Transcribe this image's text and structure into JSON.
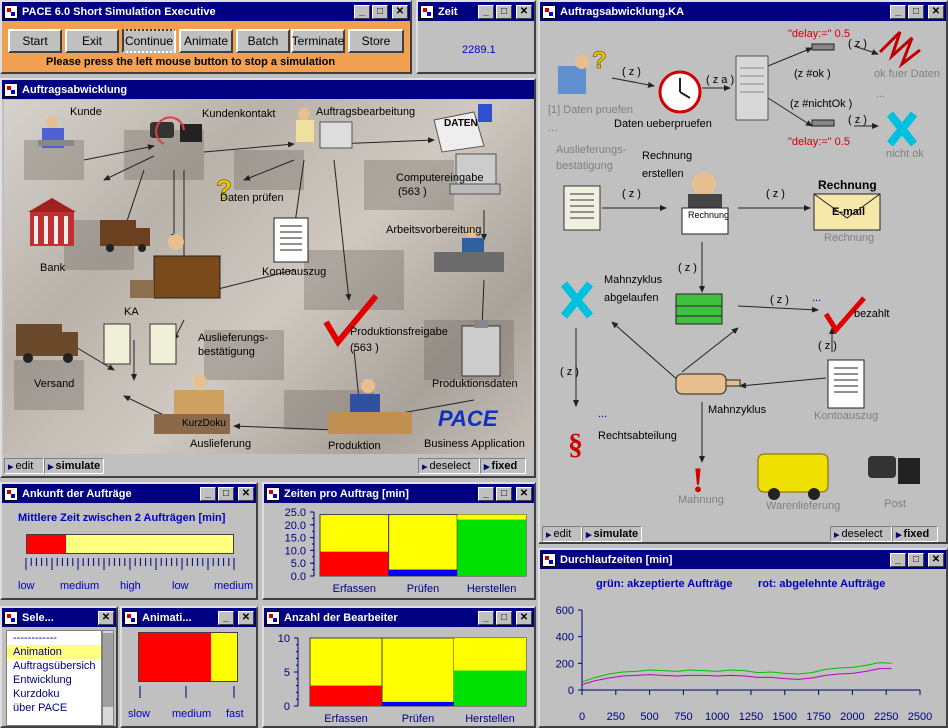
{
  "pace": {
    "title": "PACE 6.0   Short Simulation Executive",
    "buttons": [
      "Start",
      "Exit",
      "Continue",
      "Animate",
      "Batch",
      "Terminate",
      "Store"
    ],
    "message": "Please press the left mouse button to stop a simulation"
  },
  "zeit": {
    "title": "Zeit",
    "value": "2289.1"
  },
  "auftrag": {
    "title": "Auftragsabwicklung",
    "labels": {
      "kunde": "Kunde",
      "kundenkontakt": "Kundenkontakt",
      "auftragsbearbeitung": "Auftragsbearbeitung",
      "daten_pruefen": "Daten prüfen",
      "computereingabe": "Computereingabe",
      "computer_count": "(563 )",
      "arbeitsvorbereitung": "Arbeitsvorbereitung",
      "bank": "Bank",
      "kontoauszug": "Kontoauszug",
      "ka": "KA",
      "auslieferungs": "Auslieferungs-",
      "bestaetigung": "bestätigung",
      "produktionsfreigabe": "Produktionsfreigabe",
      "freigabe_count": "(563 )",
      "versand": "Versand",
      "produktionsdaten": "Produktionsdaten",
      "kurzdoku": "KurzDoku",
      "auslieferung": "Auslieferung",
      "produktion": "Produktion",
      "pace_logo": "PACE",
      "business": "Business Application",
      "daten_sign": "DATEN"
    },
    "status": {
      "edit": "edit",
      "simulate": "simulate",
      "deselect": "deselect",
      "fixed": "fixed"
    }
  },
  "ka": {
    "title": "Auftragsabwicklung.KA",
    "labels": {
      "daten_pruefen_count": "[1] Daten pruefen",
      "dots1": "...",
      "daten_ueberpruefen": "Daten ueberpruefen",
      "z1": "( z )",
      "za": "( z a )",
      "delay1": "\"delay:=\" 0.5",
      "z2": "( z )",
      "z_ok": "(z #ok )",
      "ok_fuer_daten": "ok fuer Daten",
      "dots2": "...",
      "z_nichtok": "(z #nichtOk )",
      "z3": "( z )",
      "delay2": "\"delay:=\" 0.5",
      "nicht_ok": "nicht ok",
      "auslieferungs": "Auslieferungs-",
      "bestaetigung": "bestätigung",
      "rechnung_erstellen_1": "Rechnung",
      "rechnung_erstellen_2": "erstellen",
      "z4": "( z )",
      "z5": "( z )",
      "rechnung_sign": "Rechnung",
      "rechnung_paper": "Rechnung",
      "email": "E-mail",
      "rechnung": "Rechnung",
      "z6": "( z )",
      "mahnzyklus_abgelaufen_1": "Mahnzyklus",
      "mahnzyklus_abgelaufen_2": "abgelaufen",
      "z7": "( z )",
      "dots3": "...",
      "bezahlt": "bezahlt",
      "z8": "( z )",
      "z9": "( z )",
      "mahnzyklus": "Mahnzyklus",
      "kontoauszug": "Kontoauszug",
      "dots4": "...",
      "rechtsabteilung": "Rechtsabteilung",
      "mahnung": "Mahnung",
      "warenlieferung": "Warenlieferung",
      "post": "Post"
    },
    "status": {
      "edit": "edit",
      "simulate": "simulate",
      "deselect": "deselect",
      "fixed": "fixed"
    }
  },
  "ankunft": {
    "title": "Ankunft der Aufträge",
    "heading": "Mittlere Zeit zwischen 2 Aufträgen [min]",
    "fill_fraction": 0.19,
    "scale_labels": [
      "low",
      "medium",
      "high",
      "low",
      "medium"
    ]
  },
  "zeiten": {
    "title": "Zeiten pro Auftrag [min]",
    "ticks": [
      "25.0",
      "20.0",
      "15.0",
      "10.0",
      "5.0",
      "0.0"
    ]
  },
  "select": {
    "title": "Sele...",
    "items": [
      "------------",
      "Animation",
      "Auftragsübersich",
      "Entwicklung",
      "Kurzdoku",
      "über PACE"
    ],
    "selected_index": 1
  },
  "animation": {
    "title": "Animati...",
    "speed_fraction": 0.73,
    "labels": [
      "slow",
      "medium",
      "fast"
    ]
  },
  "bearbeiter": {
    "title": "Anzahl der Bearbeiter",
    "ticks": [
      "10",
      "5",
      "0"
    ]
  },
  "durchlauf": {
    "title": "Durchlaufzeiten [min]",
    "legend_green": "grün: akzeptierte Aufträge",
    "legend_red": "rot: abgelehnte Aufträge"
  },
  "colors": {
    "title_bar": "#000080",
    "yellow": "#ffff00",
    "red": "#ff0000",
    "green": "#00e000",
    "blue": "#0000ff",
    "orange_toolbar": "#f0a050"
  },
  "chart_data": [
    {
      "type": "bar",
      "title": "Zeiten pro Auftrag [min]",
      "categories": [
        "Erfassen",
        "Prüfen",
        "Herstellen"
      ],
      "series": [
        {
          "name": "",
          "values": [
            9.5,
            2.5,
            22.0
          ]
        },
        {
          "name": "",
          "values": [
            24.0,
            24.0,
            24.0
          ]
        }
      ],
      "ylim": [
        0,
        25
      ]
    },
    {
      "type": "bar",
      "title": "Anzahl der Bearbeiter",
      "categories": [
        "Erfassen",
        "Prüfen",
        "Herstellen"
      ],
      "series": [
        {
          "name": "",
          "values": [
            3,
            0.6,
            5.2
          ]
        },
        {
          "name": "",
          "values": [
            10,
            10,
            10
          ]
        }
      ],
      "ylim": [
        0,
        10
      ]
    },
    {
      "type": "line",
      "title": "Durchlaufzeiten [min]",
      "x_ticks": [
        "0",
        "250",
        "500",
        "750",
        "1000",
        "1250",
        "1500",
        "1750",
        "2000",
        "2250",
        "2500"
      ],
      "y_ticks": [
        "600",
        "400",
        "200",
        "0"
      ],
      "xlim": [
        0,
        2500
      ],
      "ylim": [
        0,
        600
      ],
      "series": [
        {
          "name": "grün: akzeptierte Aufträge",
          "x": [
            0,
            100,
            200,
            300,
            400,
            500,
            600,
            700,
            800,
            900,
            1000,
            1100,
            1200,
            1300,
            1400,
            1500,
            1600,
            1700,
            1800,
            1900,
            2000,
            2100,
            2200,
            2289
          ],
          "values": [
            60,
            95,
            120,
            135,
            140,
            150,
            145,
            140,
            150,
            145,
            140,
            150,
            145,
            130,
            135,
            125,
            120,
            130,
            155,
            165,
            170,
            185,
            205,
            200
          ]
        },
        {
          "name": "rot: abgelehnte Aufträge",
          "x": [
            0,
            100,
            200,
            300,
            400,
            500,
            600,
            700,
            800,
            900,
            1000,
            1100,
            1200,
            1300,
            1400,
            1500,
            1600,
            1700,
            1800,
            1900,
            2000,
            2100,
            2200,
            2289
          ],
          "values": [
            40,
            70,
            90,
            105,
            110,
            115,
            110,
            105,
            110,
            110,
            105,
            110,
            105,
            95,
            95,
            85,
            80,
            90,
            110,
            120,
            125,
            140,
            160,
            160
          ]
        }
      ]
    }
  ]
}
